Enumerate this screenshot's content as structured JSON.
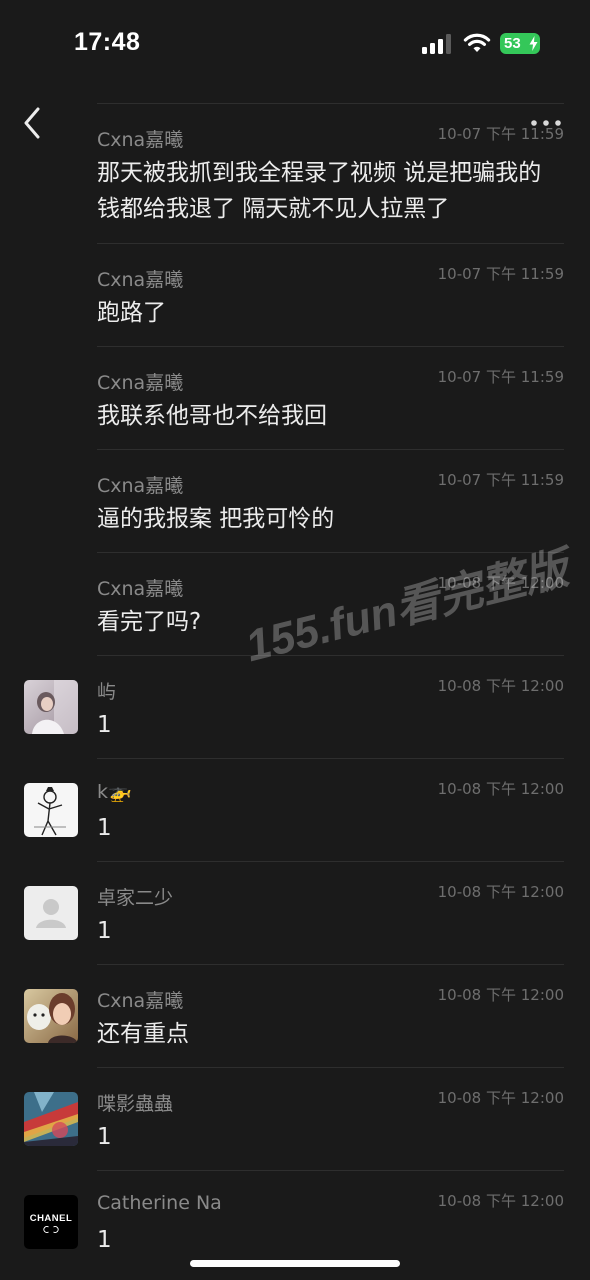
{
  "status_bar": {
    "time": "17:48",
    "battery": "53"
  },
  "nav": {
    "back_icon": "chevron-left-icon",
    "more_icon": "ellipsis-icon"
  },
  "messages": [
    {
      "sender": "Cxna嘉曦",
      "time": "10-07 下午 11:59",
      "text": "那天被我抓到我全程录了视频 说是把骗我的钱都给我退了 隔天就不见人拉黑了",
      "avatar": ""
    },
    {
      "sender": "Cxna嘉曦",
      "time": "10-07 下午 11:59",
      "text": "跑路了",
      "avatar": ""
    },
    {
      "sender": "Cxna嘉曦",
      "time": "10-07 下午 11:59",
      "text": "我联系他哥也不给我回",
      "avatar": ""
    },
    {
      "sender": "Cxna嘉曦",
      "time": "10-07 下午 11:59",
      "text": "逼的我报案 把我可怜的",
      "avatar": ""
    },
    {
      "sender": "Cxna嘉曦",
      "time": "10-08 下午 12:00",
      "text": "看完了吗?",
      "avatar": ""
    },
    {
      "sender": "屿",
      "time": "10-08 下午 12:00",
      "text": "1",
      "avatar": "photo"
    },
    {
      "sender": "k🚁",
      "time": "10-08 下午 12:00",
      "text": "1",
      "avatar": "sketch"
    },
    {
      "sender": "卓家二少",
      "time": "10-08 下午 12:00",
      "text": "1",
      "avatar": "default"
    },
    {
      "sender": "Cxna嘉曦",
      "time": "10-08 下午 12:00",
      "text": "还有重点",
      "avatar": "selfie"
    },
    {
      "sender": "喋影蟲蟲",
      "time": "10-08 下午 12:00",
      "text": "1",
      "avatar": "colorful"
    },
    {
      "sender": "Catherine Na",
      "time": "10-08 下午 12:00",
      "text": "1",
      "avatar": "chanel"
    }
  ],
  "chanel_logo_text": "CHANEL",
  "watermark": "155.fun看完整版"
}
